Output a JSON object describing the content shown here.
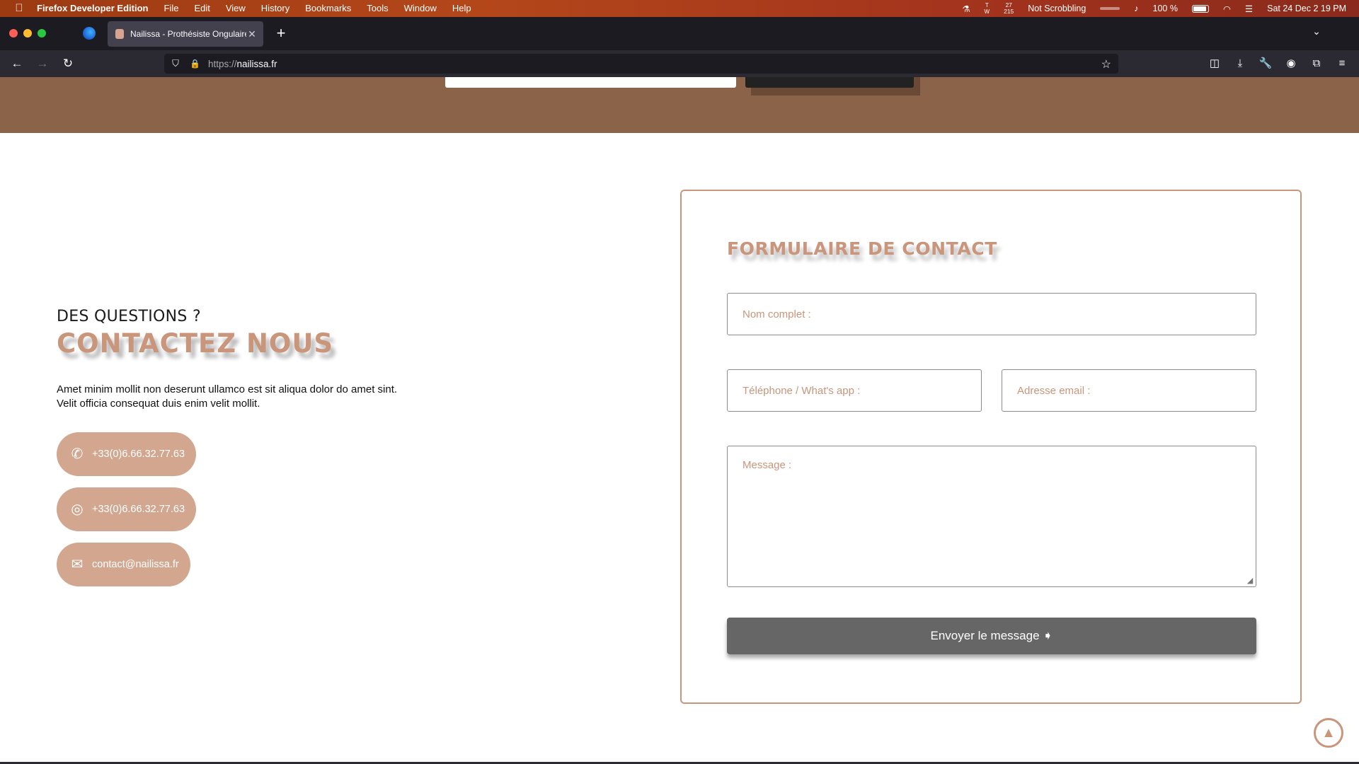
{
  "menubar": {
    "apple_icon": "apple-logo",
    "app_name": "Firefox Developer Edition",
    "menus": [
      "File",
      "Edit",
      "View",
      "History",
      "Bookmarks",
      "Tools",
      "Window",
      "Help"
    ],
    "status": {
      "tw_top": "T",
      "tw_bottom": "W",
      "stat_top": "27",
      "stat_bottom": "215",
      "scrobble": "Not Scrobbling",
      "battery": "100 %",
      "datetime": "Sat 24 Dec  2 19 PM"
    }
  },
  "browser": {
    "tab_title": "Nailissa - Prothésiste Ongulaire",
    "url_protocol": "https://",
    "url_host": "nailissa.fr"
  },
  "contact": {
    "kicker": "DES QUESTIONS ?",
    "title": "CONTACTEZ NOUS",
    "lead": "Amet minim mollit non deserunt ullamco est sit aliqua dolor do amet sint. Velit officia consequat duis enim velit mollit.",
    "phone": "+33(0)6.66.32.77.63",
    "whatsapp": "+33(0)6.66.32.77.63",
    "email": "contact@nailissa.fr"
  },
  "form": {
    "title": "FORMULAIRE DE CONTACT",
    "name_placeholder": "Nom complet :",
    "phone_placeholder": "Téléphone / What's app :",
    "email_placeholder": "Adresse email :",
    "message_placeholder": "Message :",
    "submit_label": "Envoyer le message ➧"
  },
  "colors": {
    "accent": "#c9957b",
    "pill": "#d3a78f",
    "band": "#8b6348",
    "submit": "#666666"
  }
}
